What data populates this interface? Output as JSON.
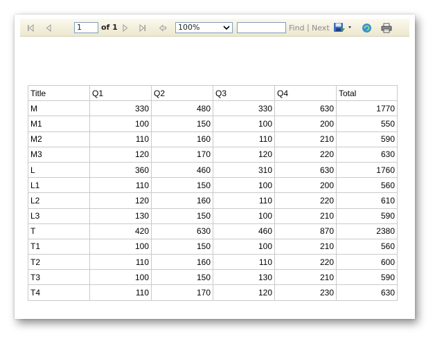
{
  "toolbar": {
    "page_current": "1",
    "page_of_label": "of 1",
    "zoom_value": "100%",
    "find_label": "Find",
    "separator": "|",
    "next_label": "Next",
    "find_placeholder": ""
  },
  "table": {
    "headers": [
      "Title",
      "Q1",
      "Q2",
      "Q3",
      "Q4",
      "Total"
    ],
    "rows": [
      [
        "M",
        "330",
        "480",
        "330",
        "630",
        "1770"
      ],
      [
        "M1",
        "100",
        "150",
        "100",
        "200",
        "550"
      ],
      [
        "M2",
        "110",
        "160",
        "110",
        "210",
        "590"
      ],
      [
        "M3",
        "120",
        "170",
        "120",
        "220",
        "630"
      ],
      [
        "L",
        "360",
        "460",
        "310",
        "630",
        "1760"
      ],
      [
        "L1",
        "110",
        "150",
        "100",
        "200",
        "560"
      ],
      [
        "L2",
        "120",
        "160",
        "110",
        "220",
        "610"
      ],
      [
        "L3",
        "130",
        "150",
        "100",
        "210",
        "590"
      ],
      [
        "T",
        "420",
        "630",
        "460",
        "870",
        "2380"
      ],
      [
        "T1",
        "100",
        "150",
        "100",
        "210",
        "560"
      ],
      [
        "T2",
        "110",
        "160",
        "110",
        "220",
        "600"
      ],
      [
        "T3",
        "100",
        "150",
        "130",
        "210",
        "590"
      ],
      [
        "T4",
        "110",
        "170",
        "120",
        "230",
        "630"
      ]
    ]
  },
  "icons": {
    "first_page": "first-page-icon",
    "prev_page": "previous-page-icon",
    "next_page": "next-page-icon",
    "last_page": "last-page-icon",
    "back": "back-to-parent-icon",
    "export": "export-icon",
    "refresh": "refresh-icon",
    "print": "print-icon"
  }
}
